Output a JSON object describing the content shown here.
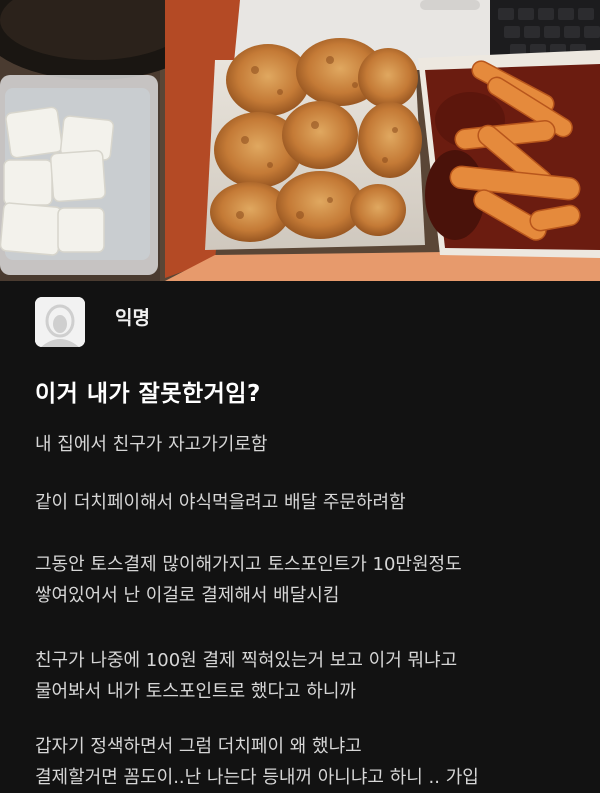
{
  "photo": {
    "icon": "fried-chicken-and-tteokbokki-photo"
  },
  "post": {
    "author": "익명",
    "title": "이거 내가 잘못한거임?",
    "paragraphs": [
      {
        "lines": [
          "내 집에서 친구가 자고가기로함"
        ]
      },
      {
        "lines": [
          "같이 더치페이해서 야식먹을려고 배달 주문하려함"
        ]
      },
      {
        "lines": [
          "그동안 토스결제 많이해가지고 토스포인트가 10만원정도",
          "쌓여있어서 난 이걸로 결제해서 배달시킴"
        ]
      },
      {
        "lines": [
          "친구가 나중에 100원 결제 찍혀있는거 보고 이거 뭐냐고",
          "물어봐서 내가 토스포인트로 했다고 하니까"
        ]
      },
      {
        "lines": [
          "갑자기 정색하면서 그럼 더치페이 왜 했냐고",
          "결제할거면 꼼도이..난 나는다 등내꺼 아니냐고 하니 .. 가입"
        ]
      }
    ]
  }
}
